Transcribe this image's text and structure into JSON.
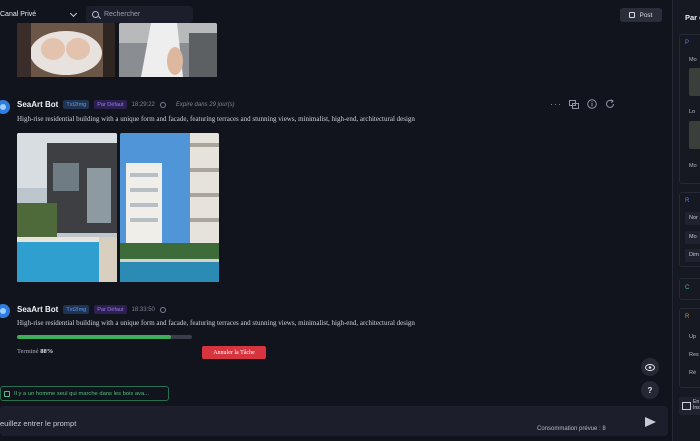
{
  "topbar": {
    "channel": "Canal Privé",
    "search_placeholder": "Rechercher",
    "post_label": "Post"
  },
  "messages": [
    {
      "bot_name": "SeaArt Bot",
      "model_badge": "Txt2Img",
      "mode_badge": "Par Défaut",
      "time": "18:29:22",
      "remaining": "Expire dans 29 jour(s)",
      "prompt": "High-rise residential building with a unique form and facade, featuring terraces and stunning views, minimalist, high-end, architectural design"
    },
    {
      "bot_name": "SeaArt Bot",
      "model_badge": "Txt2Img",
      "mode_badge": "Par Défaut",
      "time": "18:33:50",
      "prompt": "High-rise residential building with a unique form and facade, featuring terraces and stunning views, minimalist, high-end, architectural design",
      "status_label": "Terminé",
      "progress_text": "88%",
      "progress": 0.88,
      "cancel_label": "Annuler la Tâche"
    }
  ],
  "float": {
    "help_label": "?"
  },
  "suggestion": "Il y a un homme seul qui marche dans les bois ava...",
  "input": {
    "placeholder": "euillez entrer le prompt",
    "consumption": "Consommation prévue : 8"
  },
  "right_panel": {
    "title": "Par d",
    "sections": {
      "s1": "P",
      "s2": "R",
      "s3": "C",
      "s4": "R"
    },
    "items": {
      "i1": "Mo",
      "i2": "Lo",
      "i3": "Mo",
      "chip1": "Nor",
      "chip2": "Mo",
      "chip3": "Dim",
      "i4": "Up",
      "i5": "Res",
      "i6": "Ré"
    },
    "footer_a": "En",
    "footer_b": "Ins"
  },
  "colors": {
    "background": "#12141d",
    "accent_blue": "#5c9cf0",
    "progress_green": "#3fae5a",
    "danger_red": "#d6353f"
  }
}
